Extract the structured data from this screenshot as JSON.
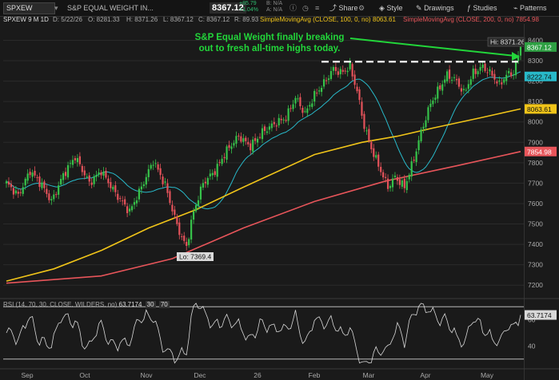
{
  "toolbar": {
    "symbol": "SPXEW",
    "description": "S&P EQUAL WEIGHT IN...",
    "last_price": "8367.12",
    "change": "+85.79",
    "change_pct": "+1.04%",
    "bid": "B: N/A",
    "ask": "A: N/A",
    "share_label": "Share",
    "style_label": "Style",
    "drawings_label": "Drawings",
    "studies_label": "Studies",
    "patterns_label": "Patterns"
  },
  "chart_header": {
    "period": "SPXEW 9 M 1D",
    "date": "D: 5/22/26",
    "open": "O: 8281.33",
    "high": "H: 8371.26",
    "low": "L: 8367.12",
    "close": "C: 8367.12",
    "range": "R: 89.93",
    "sma100_label": "SimpleMovingAvg (CLOSE, 100, 0, no)",
    "sma100_value": "8063.61",
    "sma200_label": "SimpleMovingAvg (CLOSE, 200, 0, no)",
    "sma200_value": "7854.98"
  },
  "annotation": {
    "line1": "S&P Equal Weight finally breaking",
    "line2": "out to fresh all-time highs today."
  },
  "colors": {
    "up": "#36c24a",
    "down": "#e4525a",
    "sma20": "#28b9c9",
    "sma100": "#f0c419",
    "sma200": "#e8555a",
    "callout": "#22d63a"
  },
  "chart_data": {
    "type": "candlestick",
    "ylim": [
      7150,
      8480
    ],
    "yticks": [
      7200,
      7300,
      7400,
      7500,
      7600,
      7700,
      7800,
      7900,
      8000,
      8100,
      8200,
      8300,
      8400
    ],
    "xticks": [
      "Sep",
      "Oct",
      "Nov",
      "Dec",
      "26",
      "Feb",
      "Mar",
      "Apr",
      "May"
    ],
    "labels": {
      "high": "Hi: 8371.26",
      "low": "Lo: 7369.4",
      "last": "8367.12",
      "sma20_tag": "8222.74",
      "sma100_tag": "8063.61",
      "sma200_tag": "7854.98"
    },
    "resistance_level": 8295,
    "anchors": [
      [
        0,
        7700
      ],
      [
        5,
        7640
      ],
      [
        10,
        7760
      ],
      [
        15,
        7690
      ],
      [
        19,
        7610
      ],
      [
        24,
        7740
      ],
      [
        29,
        7830
      ],
      [
        35,
        7700
      ],
      [
        40,
        7760
      ],
      [
        46,
        7650
      ],
      [
        52,
        7560
      ],
      [
        57,
        7680
      ],
      [
        62,
        7810
      ],
      [
        67,
        7690
      ],
      [
        71,
        7530
      ],
      [
        74,
        7430
      ],
      [
        76,
        7390
      ],
      [
        79,
        7560
      ],
      [
        83,
        7700
      ],
      [
        88,
        7760
      ],
      [
        93,
        7860
      ],
      [
        98,
        7930
      ],
      [
        103,
        7880
      ],
      [
        108,
        7950
      ],
      [
        113,
        7990
      ],
      [
        118,
        8020
      ],
      [
        122,
        8120
      ],
      [
        126,
        8040
      ],
      [
        130,
        8130
      ],
      [
        134,
        8190
      ],
      [
        138,
        8260
      ],
      [
        141,
        8240
      ],
      [
        145,
        8270
      ],
      [
        148,
        8150
      ],
      [
        151,
        7980
      ],
      [
        154,
        7870
      ],
      [
        158,
        7760
      ],
      [
        161,
        7680
      ],
      [
        164,
        7730
      ],
      [
        168,
        7680
      ],
      [
        172,
        7820
      ],
      [
        175,
        7950
      ],
      [
        179,
        8090
      ],
      [
        183,
        8170
      ],
      [
        186,
        8230
      ],
      [
        190,
        8200
      ],
      [
        193,
        8140
      ],
      [
        197,
        8240
      ],
      [
        201,
        8270
      ],
      [
        205,
        8230
      ],
      [
        208,
        8180
      ],
      [
        211,
        8230
      ],
      [
        214,
        8240
      ],
      [
        217,
        8367
      ]
    ],
    "series": [
      {
        "name": "SimpleMovingAvg (CLOSE, 100, 0, no)",
        "values": [
          [
            0,
            7220
          ],
          [
            20,
            7280
          ],
          [
            40,
            7370
          ],
          [
            60,
            7480
          ],
          [
            80,
            7570
          ],
          [
            100,
            7680
          ],
          [
            130,
            7840
          ],
          [
            150,
            7900
          ],
          [
            165,
            7930
          ],
          [
            180,
            7970
          ],
          [
            200,
            8020
          ],
          [
            217,
            8063.61
          ]
        ]
      },
      {
        "name": "SimpleMovingAvg (CLOSE, 200, 0, no)",
        "values": [
          [
            0,
            7210
          ],
          [
            40,
            7245
          ],
          [
            70,
            7330
          ],
          [
            100,
            7480
          ],
          [
            130,
            7610
          ],
          [
            160,
            7710
          ],
          [
            190,
            7785
          ],
          [
            217,
            7854.98
          ]
        ]
      }
    ],
    "rsi": {
      "label": "RSI (14, 70, 30, CLOSE, WILDERS, no)",
      "value": "63.7174",
      "levels": [
        "30",
        "70"
      ],
      "yticks": [
        40,
        60
      ],
      "ylim": [
        25,
        75
      ]
    }
  }
}
